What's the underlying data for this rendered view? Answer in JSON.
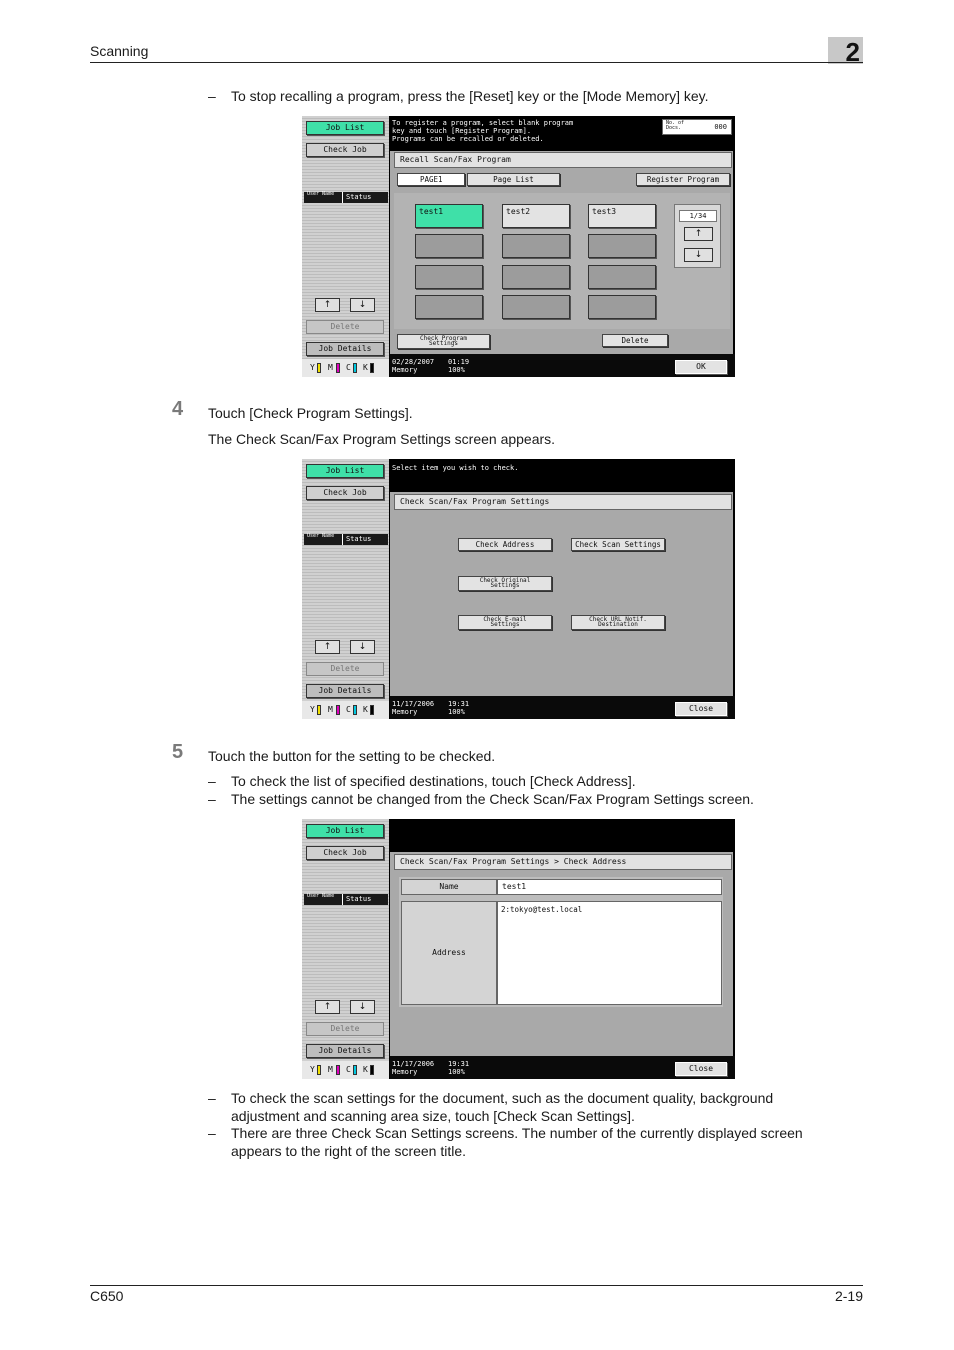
{
  "header": {
    "section": "Scanning",
    "chapter": "2"
  },
  "intro": {
    "dash": "–",
    "text": "To stop recalling a program, press the [Reset] key or the [Mode Memory] key."
  },
  "step4": {
    "number": "4",
    "instruction": "Touch [Check Program Settings].",
    "result": "The Check Scan/Fax Program Settings screen appears."
  },
  "step5": {
    "number": "5",
    "instruction": "Touch the button for the setting to be checked.",
    "bullets": [
      "To check the list of specified destinations, touch [Check Address].",
      "The settings cannot be changed from the Check Scan/Fax Program Settings screen."
    ]
  },
  "after_bullets": [
    "To check the scan settings for the document, such as the document quality, background adjustment and scanning area size, touch [Check Scan Settings].",
    "There are three Check Scan Settings screens. The number of the currently displayed screen appears to the right of the screen title."
  ],
  "dash": "–",
  "left_panel": {
    "job_list": "Job List",
    "check_job": "Check Job",
    "user_name": "User Name",
    "status": "Status",
    "up": "↑",
    "down": "↓",
    "delete": "Delete",
    "job_details": "Job Details",
    "toner": [
      "Y",
      "M",
      "C",
      "K"
    ]
  },
  "colors": {
    "y": "#f0e000",
    "m": "#e000c0",
    "c": "#00c8e0",
    "k": "#000000",
    "green": "#3fe0a8"
  },
  "screen1": {
    "message": "To register a program, select blank program\nkey and touch [Register Program].\nPrograms can be recalled or deleted.",
    "doc_label": "No. of\nDocs.",
    "doc_count": "000",
    "title": "Recall Scan/Fax Program",
    "tab_page1": "PAGE1",
    "tab_page_list": "Page List",
    "register_program": "Register Program",
    "programs": [
      "test1",
      "test2",
      "test3"
    ],
    "page_indicator": "1/34",
    "check_program_settings": "Check Program\nSettings",
    "delete": "Delete",
    "date": "02/28/2007",
    "time": "01:19",
    "memory_label": "Memory",
    "memory_value": "100%",
    "ok": "OK"
  },
  "screen2": {
    "message": "Select item you wish to check.",
    "title": "Check Scan/Fax Program Settings",
    "check_address": "Check Address",
    "check_scan_settings": "Check Scan Settings",
    "check_original_settings": "Check Original\nSettings",
    "check_email_settings": "Check E-mail\nSettings",
    "check_url_destination": "Check URL Notif.\nDestination",
    "date": "11/17/2006",
    "time": "19:31",
    "memory_label": "Memory",
    "memory_value": "100%",
    "close": "Close"
  },
  "screen3": {
    "title": "Check Scan/Fax Program Settings > Check Address",
    "name_label": "Name",
    "name_value": "test1",
    "address_label": "Address",
    "address_value": "2:tokyo@test.local",
    "date": "11/17/2006",
    "time": "19:31",
    "memory_label": "Memory",
    "memory_value": "100%",
    "close": "Close"
  },
  "footer": {
    "model": "C650",
    "page": "2-19"
  }
}
